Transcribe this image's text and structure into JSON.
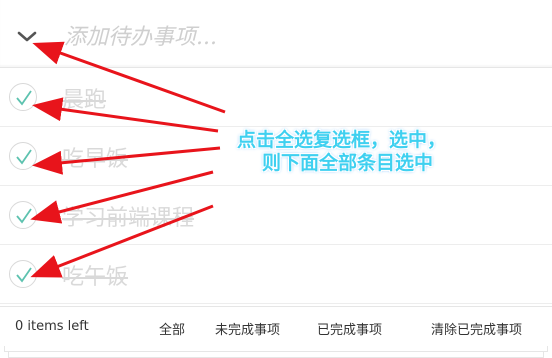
{
  "header": {
    "toggle_all_icon": "chevron-down-icon",
    "new_todo_placeholder": "添加待办事项..."
  },
  "todos": [
    {
      "label": "晨跑",
      "completed": true
    },
    {
      "label": "吃早饭",
      "completed": true
    },
    {
      "label": "学习前端课程",
      "completed": true
    },
    {
      "label": "吃午饭",
      "completed": true
    }
  ],
  "footer": {
    "items_left": "0 items left",
    "filters": [
      "全部",
      "未完成事项",
      "已完成事项"
    ],
    "clear_completed": "清除已完成事项"
  },
  "annotation": {
    "line1": "点击全选复选框，选中，",
    "line2": "则下面全部条目选中"
  },
  "colors": {
    "check_mark": "#5dc2af",
    "arrow": "#e8141b",
    "annotation_text": "#3fd0f0",
    "completed_text": "#d9d9d9"
  }
}
